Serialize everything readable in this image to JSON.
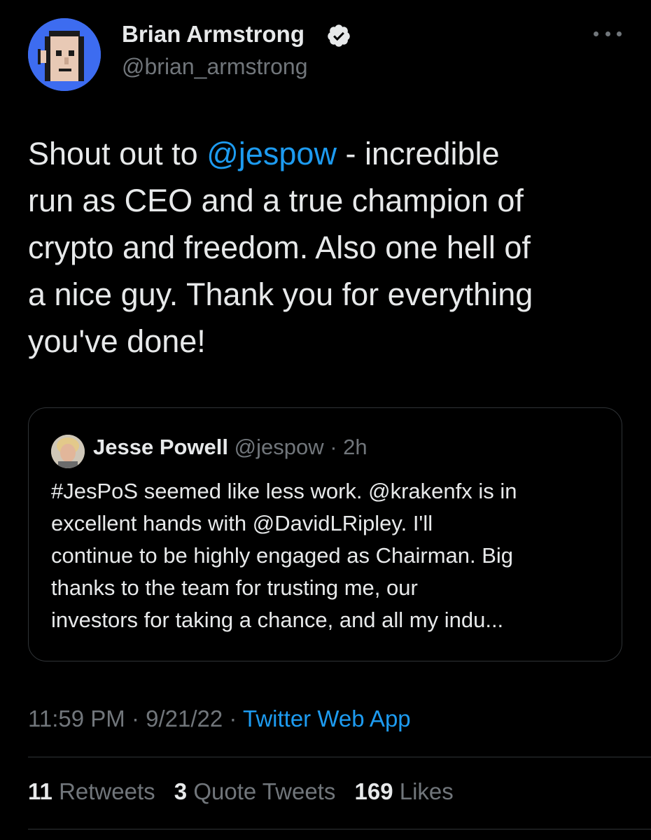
{
  "author": {
    "display_name": "Brian Armstrong",
    "handle": "@brian_armstrong",
    "verified": true,
    "avatar_color": "#3d6cf0"
  },
  "tweet": {
    "lines": [
      {
        "pre": "Shout out to ",
        "mention": "@jespow",
        "post": " - incredible"
      },
      {
        "text": "run as CEO and a true champion of"
      },
      {
        "text": "crypto and freedom. Also one hell of"
      },
      {
        "text": "a nice guy. Thank you for everything"
      },
      {
        "text": "you've done!"
      }
    ]
  },
  "quoted_tweet": {
    "name": "Jesse Powell",
    "handle": "@jespow",
    "separator": " · ",
    "time": "2h",
    "lines": [
      "#JesPoS seemed like less work. @krakenfx is in",
      "excellent hands with @DavidLRipley. I'll",
      "continue to be highly engaged as Chairman. Big",
      "thanks to the team for trusting me, our",
      "investors for taking a chance, and all my indu..."
    ]
  },
  "meta": {
    "time": "11:59 PM",
    "sep1": " · ",
    "date": "9/21/22",
    "sep2": " · ",
    "source": "Twitter Web App"
  },
  "stats": {
    "retweets_count": "11",
    "retweets_label": "Retweets",
    "quotes_count": "3",
    "quotes_label": "Quote Tweets",
    "likes_count": "169",
    "likes_label": "Likes"
  },
  "colors": {
    "background": "#000000",
    "text": "#e7e9ea",
    "secondary": "#71767b",
    "accent": "#1d9bf0",
    "border": "#2f3336"
  },
  "icons": {
    "verified": "verified-badge-icon",
    "more": "more-dots-icon"
  }
}
